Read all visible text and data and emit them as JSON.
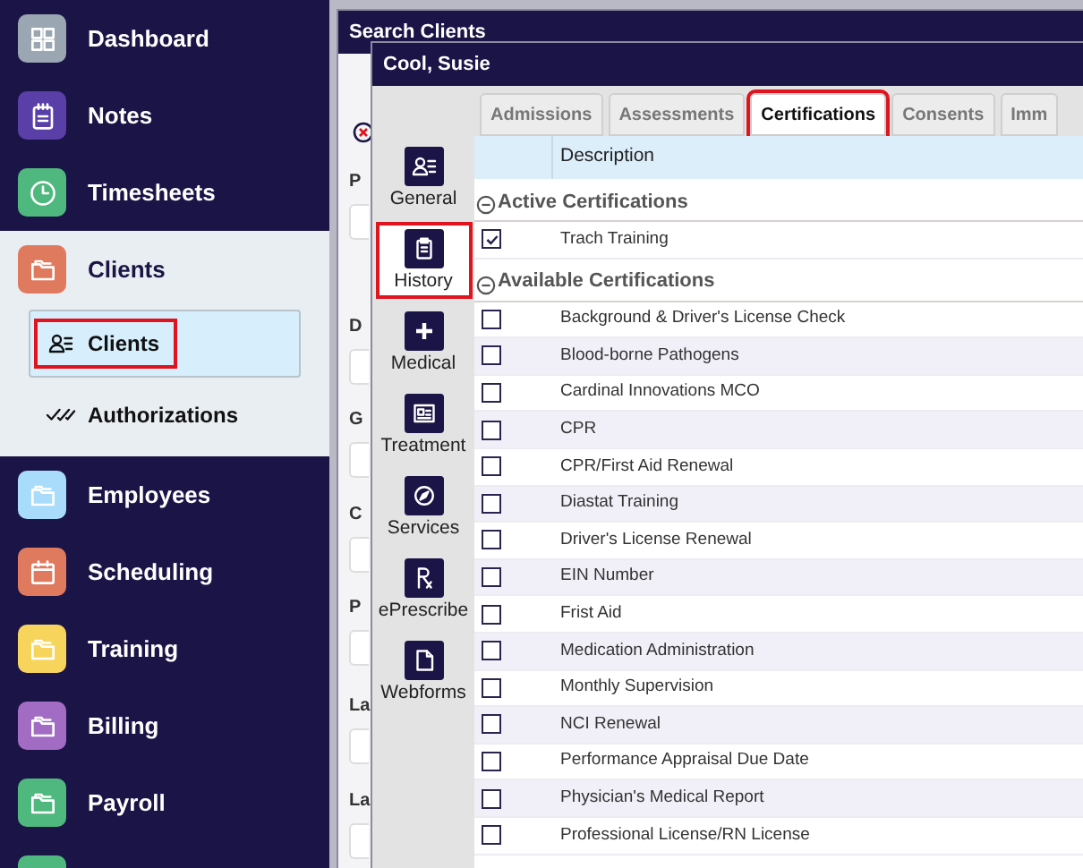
{
  "sidebar": {
    "items": [
      {
        "label": "Dashboard",
        "kind": "grid",
        "color": "#9aa6b2",
        "expanded": false
      },
      {
        "label": "Notes",
        "kind": "notepad",
        "color": "#5a3fa8",
        "expanded": false
      },
      {
        "label": "Timesheets",
        "kind": "clock",
        "color": "#4fb87e",
        "expanded": false
      },
      {
        "label": "Clients",
        "kind": "folder",
        "color": "#e07a5f",
        "expanded": true,
        "children": [
          {
            "label": "Clients",
            "kind": "person",
            "selected": true,
            "highlighted": true
          },
          {
            "label": "Authorizations",
            "kind": "checks",
            "selected": false,
            "highlighted": false
          }
        ]
      },
      {
        "label": "Employees",
        "kind": "folder",
        "color": "#a9dcfb",
        "expanded": false
      },
      {
        "label": "Scheduling",
        "kind": "calendar",
        "color": "#e07a5f",
        "expanded": false
      },
      {
        "label": "Training",
        "kind": "folder",
        "color": "#f7d55c",
        "expanded": false
      },
      {
        "label": "Billing",
        "kind": "folder",
        "color": "#a26bc4",
        "expanded": false
      },
      {
        "label": "Payroll",
        "kind": "folder",
        "color": "#4fb87e",
        "expanded": false
      }
    ]
  },
  "search_window": {
    "title": "Search Clients",
    "labels": [
      "P",
      "D",
      "G",
      "C",
      "P",
      "La",
      "La"
    ]
  },
  "client_window": {
    "title": "Cool, Susie",
    "nav": [
      {
        "label": "General",
        "kind": "person",
        "highlighted": false
      },
      {
        "label": "History",
        "kind": "clipboard",
        "highlighted": true
      },
      {
        "label": "Medical",
        "kind": "plus",
        "highlighted": false
      },
      {
        "label": "Treatment",
        "kind": "card",
        "highlighted": false
      },
      {
        "label": "Services",
        "kind": "compass",
        "highlighted": false
      },
      {
        "label": "ePrescribe",
        "kind": "rx",
        "highlighted": false
      },
      {
        "label": "Webforms",
        "kind": "document",
        "highlighted": false
      }
    ],
    "tabs": [
      {
        "label": "Admissions",
        "selected": false,
        "highlighted": false
      },
      {
        "label": "Assessments",
        "selected": false,
        "highlighted": false
      },
      {
        "label": "Certifications",
        "selected": true,
        "highlighted": true
      },
      {
        "label": "Consents",
        "selected": false,
        "highlighted": false
      },
      {
        "label": "Imm",
        "selected": false,
        "highlighted": false
      }
    ],
    "table": {
      "columns": [
        "Description"
      ],
      "groups": [
        {
          "title": "Active Certifications",
          "expanded": true,
          "rows": [
            {
              "description": "Trach Training",
              "checked": true
            }
          ]
        },
        {
          "title": "Available Certifications",
          "expanded": true,
          "rows": [
            {
              "description": "Background & Driver's License Check",
              "checked": false
            },
            {
              "description": "Blood-borne Pathogens",
              "checked": false
            },
            {
              "description": "Cardinal Innovations MCO",
              "checked": false
            },
            {
              "description": "CPR",
              "checked": false
            },
            {
              "description": "CPR/First Aid Renewal",
              "checked": false
            },
            {
              "description": "Diastat Training",
              "checked": false
            },
            {
              "description": "Driver's License Renewal",
              "checked": false
            },
            {
              "description": "EIN Number",
              "checked": false
            },
            {
              "description": "Frist Aid",
              "checked": false
            },
            {
              "description": "Medication Administration",
              "checked": false
            },
            {
              "description": "Monthly Supervision",
              "checked": false
            },
            {
              "description": "NCI Renewal",
              "checked": false
            },
            {
              "description": "Performance Appraisal Due Date",
              "checked": false
            },
            {
              "description": "Physician's Medical Report",
              "checked": false
            },
            {
              "description": "Professional License/RN License",
              "checked": false
            }
          ]
        }
      ]
    }
  }
}
